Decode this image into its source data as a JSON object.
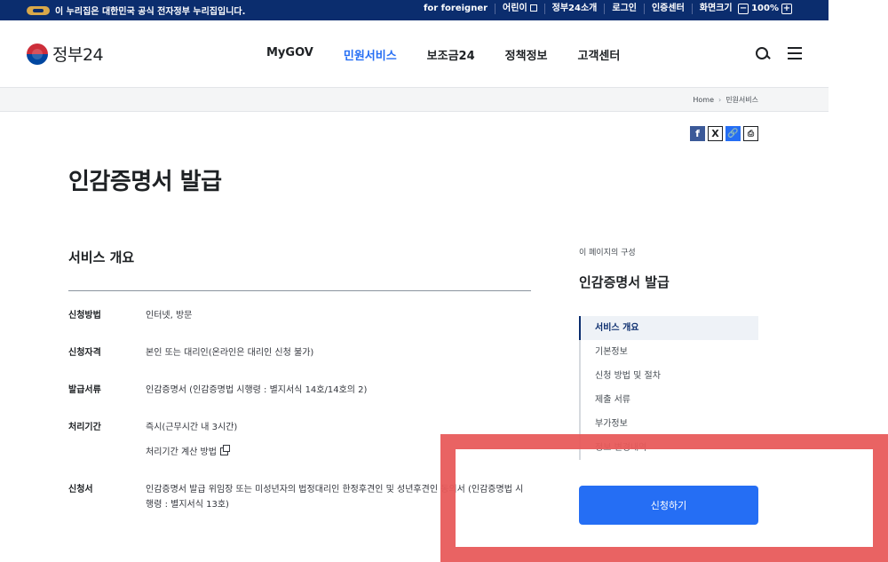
{
  "gov_banner": {
    "notice": "이 누리집은 대한민국 공식 전자정부 누리집입니다.",
    "links": [
      "for foreigner",
      "어린이",
      "정부24소개",
      "로그인",
      "인증센터"
    ],
    "zoom_label": "화면크기",
    "zoom_minus": "−",
    "zoom_value": "100%",
    "zoom_plus": "+"
  },
  "header": {
    "brand": "정부24",
    "nav": [
      "MyGOV",
      "민원서비스",
      "보조금24",
      "정책정보",
      "고객센터"
    ],
    "active_nav": "민원서비스"
  },
  "breadcrumb": {
    "home": "Home",
    "sep": "›",
    "current": "민원서비스"
  },
  "share": {
    "facebook": "f",
    "x": "X",
    "link": "🔗",
    "print": "⎙"
  },
  "page_title": "인감증명서 발급",
  "overview": {
    "title": "서비스 개요",
    "rows": [
      {
        "label": "신청방법",
        "value": "인터넷, 방문"
      },
      {
        "label": "신청자격",
        "value": "본인 또는 대리인(온라인은 대리인 신청 불가)"
      },
      {
        "label": "발급서류",
        "value": "인감증명서 (인감증명법 시행령 : 별지서식 14호/14호의 2)"
      },
      {
        "label": "처리기간",
        "value": "즉시(근무시간 내 3시간)",
        "sub_link": "처리기간 계산 방법"
      },
      {
        "label": "신청서",
        "value": "인감증명서 발급 위임장 또는 미성년자의 법정대리인 한정후견인 및 성년후견인 동의서 (인감증명법 시행령 : 별지서식 13호)"
      }
    ]
  },
  "toc": {
    "caption": "이 페이지의 구성",
    "title": "인감증명서 발급",
    "items": [
      "서비스 개요",
      "기본정보",
      "신청 방법 및 절차",
      "제출 서류",
      "부가정보",
      "정보 변경내역"
    ],
    "active_index": 0
  },
  "apply_button": "신청하기",
  "colors": {
    "gov_bar": "#0b2d6e",
    "accent": "#256ef4",
    "highlight": "#e85b5b"
  }
}
